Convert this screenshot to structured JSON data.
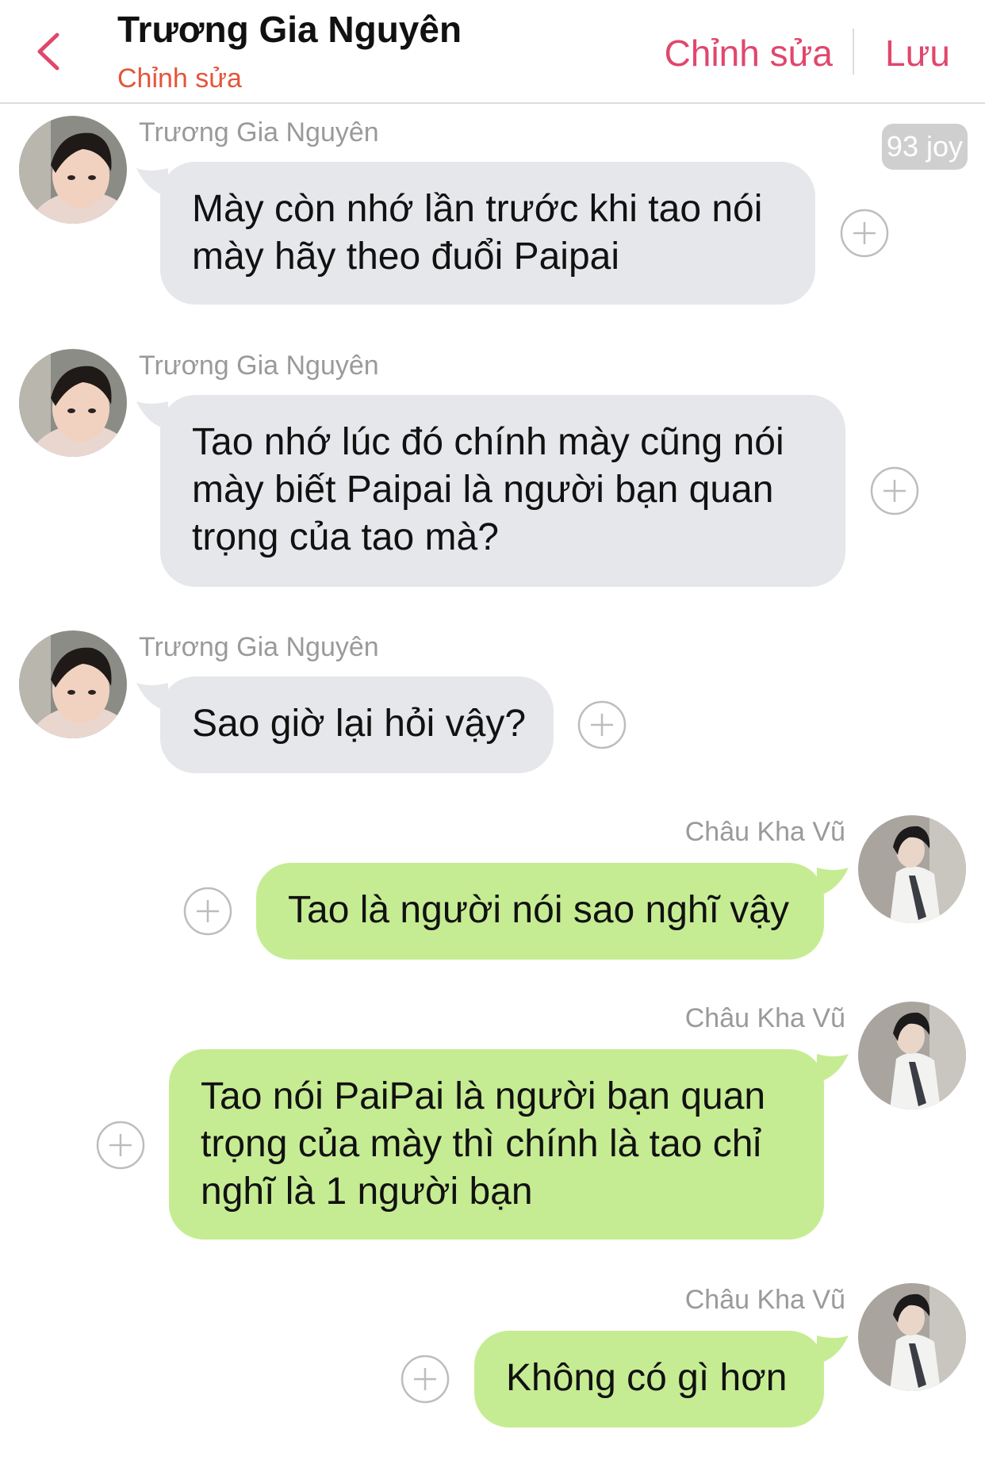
{
  "header": {
    "back_icon": "chevron-left-icon",
    "title": "Trương Gia Nguyên",
    "subtitle": "Chỉnh sửa",
    "edit_label": "Chỉnh sửa",
    "save_label": "Lưu",
    "accent": "#e0476d"
  },
  "badge": "93 joy",
  "messages": [
    {
      "sender": "Trương Gia Nguyên",
      "direction": "incoming",
      "lines": [
        "Mày còn nhớ lần trước khi tao nói",
        "mày hãy theo đuổi Paipai"
      ]
    },
    {
      "sender": "Trương Gia Nguyên",
      "direction": "incoming",
      "lines": [
        "Tao nhớ lúc đó chính mày cũng nói",
        "mày biết Paipai là người bạn quan",
        "trọng của tao mà?"
      ]
    },
    {
      "sender": "Trương Gia Nguyên",
      "direction": "incoming",
      "lines": [
        "Sao giờ lại hỏi vậy?"
      ]
    },
    {
      "sender": "Châu Kha Vũ",
      "direction": "outgoing",
      "lines": [
        "Tao là người nói sao nghĩ vậy"
      ]
    },
    {
      "sender": "Châu Kha Vũ",
      "direction": "outgoing",
      "lines": [
        "Tao nói PaiPai là người bạn quan",
        "trọng của mày thì chính là tao chỉ",
        "nghĩ là 1 người bạn"
      ]
    },
    {
      "sender": "Châu Kha Vũ",
      "direction": "outgoing",
      "lines": [
        "Không có gì hơn"
      ]
    }
  ],
  "colors": {
    "incoming_bubble": "#e5e7ea",
    "outgoing_bubble": "#c6ec93",
    "sender_name": "#9a9a9a",
    "subtitle": "#e4553b"
  },
  "icons": {
    "add": "plus-circle-icon",
    "avatar_incoming": "avatar-truong-gia-nguyen",
    "avatar_outgoing": "avatar-chau-kha-vu"
  }
}
